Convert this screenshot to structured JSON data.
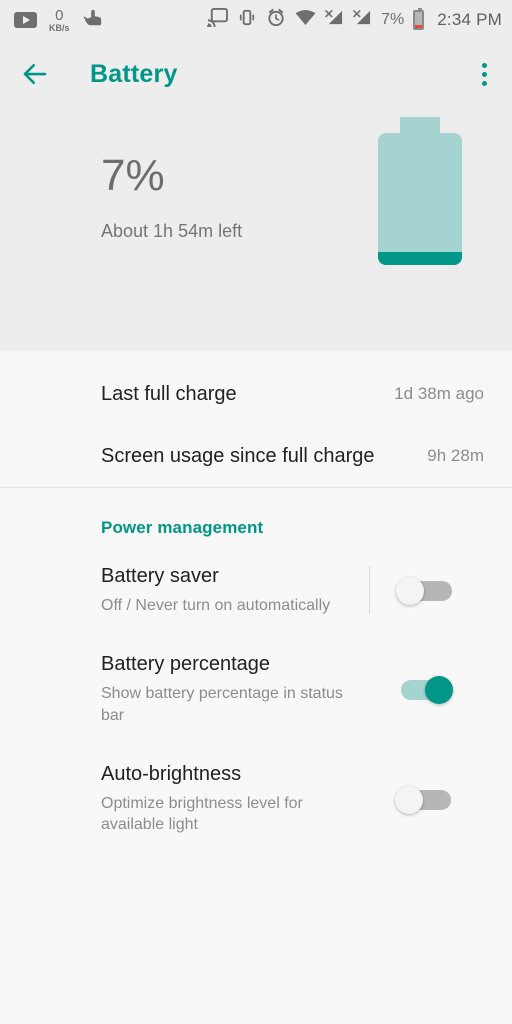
{
  "status_bar": {
    "icons_left": [
      "youtube-icon",
      "network-speed",
      "touch-gesture-icon"
    ],
    "network_speed_value": "0",
    "network_speed_unit": "KB/s",
    "icons_right": [
      "cast-icon",
      "vibrate-icon",
      "alarm-icon",
      "wifi-icon",
      "signal-no-sim-1-icon",
      "signal-no-sim-2-icon"
    ],
    "battery_percent": "7%",
    "time": "2:34 PM"
  },
  "app_bar": {
    "back_label": "back-arrow",
    "title": "Battery",
    "overflow_label": "more-options"
  },
  "battery_header": {
    "percent": "7%",
    "time_left": "About 1h 54m left",
    "fill_level": 7
  },
  "info_rows": [
    {
      "label": "Last full charge",
      "value": "1d 38m ago"
    },
    {
      "label": "Screen usage since full charge",
      "value": "9h 28m"
    }
  ],
  "power_management": {
    "header": "Power management",
    "items": [
      {
        "title": "Battery saver",
        "summary": "Off / Never turn on automatically",
        "state": "off"
      },
      {
        "title": "Battery percentage",
        "summary": "Show battery percentage in status bar",
        "state": "on"
      },
      {
        "title": "Auto-brightness",
        "summary": "Optimize brightness level for available light",
        "state": "off"
      }
    ]
  },
  "colors": {
    "accent": "#009688",
    "accent_light": "#a5d4d0",
    "header_bg": "#ededed",
    "body_bg": "#f8f8f8",
    "text_primary": "#212121",
    "text_secondary": "#8c8c8c",
    "battery_low_red": "#e8453c"
  }
}
